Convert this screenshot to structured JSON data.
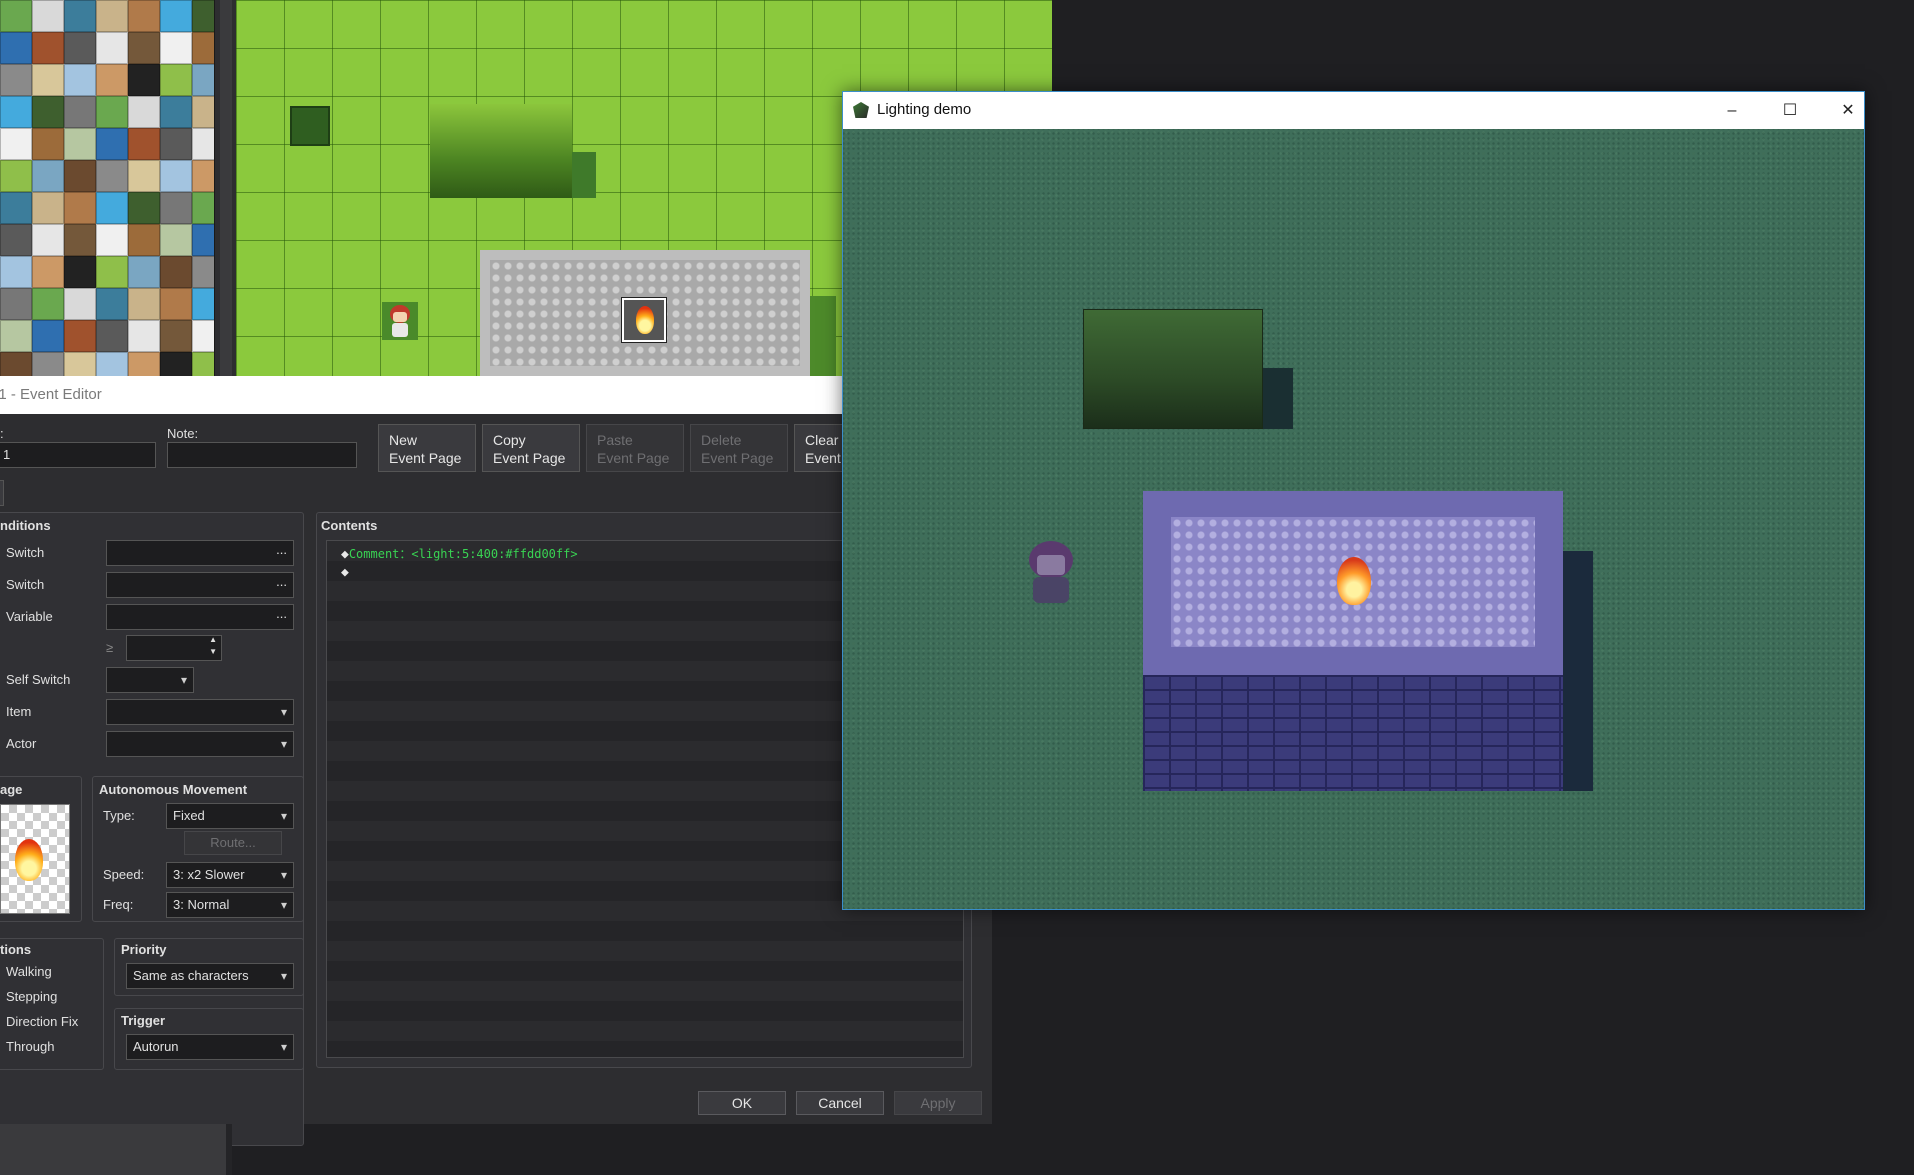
{
  "event_editor": {
    "title_prefix": "01 - ",
    "title": "Event Editor",
    "name_value": "1",
    "note_label": "Note:",
    "note_value": "",
    "buttons": {
      "new_event_page": [
        "New",
        "Event Page"
      ],
      "copy_event_page": [
        "Copy",
        "Event Page"
      ],
      "paste_event_page": [
        "Paste",
        "Event Page"
      ],
      "delete_event_page": [
        "Delete",
        "Event Page"
      ],
      "clear_event_page": [
        "Clear",
        "Event"
      ]
    },
    "conditions": {
      "header": "nditions",
      "switch1": "Switch",
      "switch2": "Switch",
      "variable": "Variable",
      "ge_symbol": "≥",
      "self_switch": "Self Switch",
      "item": "Item",
      "actor": "Actor",
      "ellipsis": "..."
    },
    "image": {
      "header": "age"
    },
    "autonomous_movement": {
      "header": "Autonomous Movement",
      "type_label": "Type:",
      "type_value": "Fixed",
      "route_button": "Route...",
      "speed_label": "Speed:",
      "speed_value": "3: x2 Slower",
      "freq_label": "Freq:",
      "freq_value": "3: Normal"
    },
    "options": {
      "header": "tions",
      "walking": "Walking",
      "stepping": "Stepping",
      "direction_fix": "Direction Fix",
      "through": "Through"
    },
    "priority": {
      "header": "Priority",
      "value": "Same as characters"
    },
    "trigger": {
      "header": "Trigger",
      "value": "Autorun"
    },
    "contents": {
      "header": "Contents",
      "commands": [
        {
          "marker": "◆",
          "text": "Comment：<light:5:400:#ffdd00ff>"
        },
        {
          "marker": "◆",
          "text": ""
        }
      ]
    },
    "dialog": {
      "ok": "OK",
      "cancel": "Cancel",
      "apply": "Apply"
    }
  },
  "demo_window": {
    "title": "Lighting demo",
    "minimize": "–",
    "maximize": "☐",
    "close": "✕"
  },
  "colors": {
    "grass_editor": "#8bc93d",
    "grass_game": "#3f6e5a",
    "comment_green": "#39d353",
    "accent_border": "#3b8ec9"
  }
}
